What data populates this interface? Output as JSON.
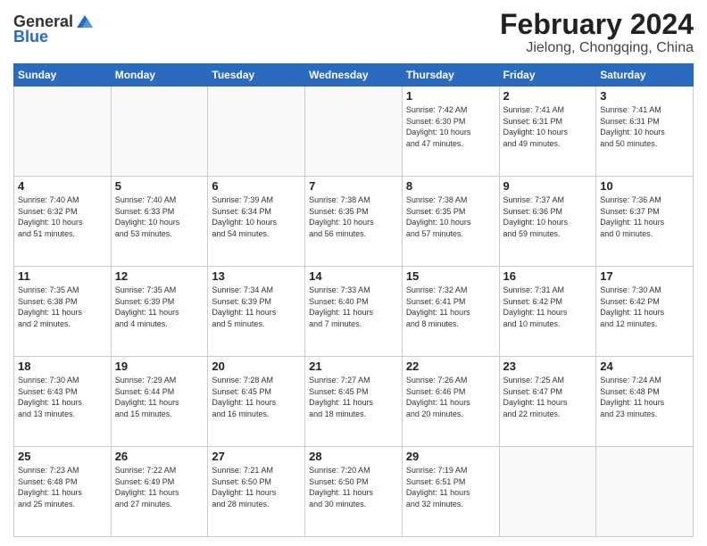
{
  "logo": {
    "general": "General",
    "blue": "Blue"
  },
  "title": "February 2024",
  "subtitle": "Jielong, Chongqing, China",
  "weekdays": [
    "Sunday",
    "Monday",
    "Tuesday",
    "Wednesday",
    "Thursday",
    "Friday",
    "Saturday"
  ],
  "weeks": [
    [
      {
        "day": "",
        "info": ""
      },
      {
        "day": "",
        "info": ""
      },
      {
        "day": "",
        "info": ""
      },
      {
        "day": "",
        "info": ""
      },
      {
        "day": "1",
        "info": "Sunrise: 7:42 AM\nSunset: 6:30 PM\nDaylight: 10 hours\nand 47 minutes."
      },
      {
        "day": "2",
        "info": "Sunrise: 7:41 AM\nSunset: 6:31 PM\nDaylight: 10 hours\nand 49 minutes."
      },
      {
        "day": "3",
        "info": "Sunrise: 7:41 AM\nSunset: 6:31 PM\nDaylight: 10 hours\nand 50 minutes."
      }
    ],
    [
      {
        "day": "4",
        "info": "Sunrise: 7:40 AM\nSunset: 6:32 PM\nDaylight: 10 hours\nand 51 minutes."
      },
      {
        "day": "5",
        "info": "Sunrise: 7:40 AM\nSunset: 6:33 PM\nDaylight: 10 hours\nand 53 minutes."
      },
      {
        "day": "6",
        "info": "Sunrise: 7:39 AM\nSunset: 6:34 PM\nDaylight: 10 hours\nand 54 minutes."
      },
      {
        "day": "7",
        "info": "Sunrise: 7:38 AM\nSunset: 6:35 PM\nDaylight: 10 hours\nand 56 minutes."
      },
      {
        "day": "8",
        "info": "Sunrise: 7:38 AM\nSunset: 6:35 PM\nDaylight: 10 hours\nand 57 minutes."
      },
      {
        "day": "9",
        "info": "Sunrise: 7:37 AM\nSunset: 6:36 PM\nDaylight: 10 hours\nand 59 minutes."
      },
      {
        "day": "10",
        "info": "Sunrise: 7:36 AM\nSunset: 6:37 PM\nDaylight: 11 hours\nand 0 minutes."
      }
    ],
    [
      {
        "day": "11",
        "info": "Sunrise: 7:35 AM\nSunset: 6:38 PM\nDaylight: 11 hours\nand 2 minutes."
      },
      {
        "day": "12",
        "info": "Sunrise: 7:35 AM\nSunset: 6:39 PM\nDaylight: 11 hours\nand 4 minutes."
      },
      {
        "day": "13",
        "info": "Sunrise: 7:34 AM\nSunset: 6:39 PM\nDaylight: 11 hours\nand 5 minutes."
      },
      {
        "day": "14",
        "info": "Sunrise: 7:33 AM\nSunset: 6:40 PM\nDaylight: 11 hours\nand 7 minutes."
      },
      {
        "day": "15",
        "info": "Sunrise: 7:32 AM\nSunset: 6:41 PM\nDaylight: 11 hours\nand 8 minutes."
      },
      {
        "day": "16",
        "info": "Sunrise: 7:31 AM\nSunset: 6:42 PM\nDaylight: 11 hours\nand 10 minutes."
      },
      {
        "day": "17",
        "info": "Sunrise: 7:30 AM\nSunset: 6:42 PM\nDaylight: 11 hours\nand 12 minutes."
      }
    ],
    [
      {
        "day": "18",
        "info": "Sunrise: 7:30 AM\nSunset: 6:43 PM\nDaylight: 11 hours\nand 13 minutes."
      },
      {
        "day": "19",
        "info": "Sunrise: 7:29 AM\nSunset: 6:44 PM\nDaylight: 11 hours\nand 15 minutes."
      },
      {
        "day": "20",
        "info": "Sunrise: 7:28 AM\nSunset: 6:45 PM\nDaylight: 11 hours\nand 16 minutes."
      },
      {
        "day": "21",
        "info": "Sunrise: 7:27 AM\nSunset: 6:45 PM\nDaylight: 11 hours\nand 18 minutes."
      },
      {
        "day": "22",
        "info": "Sunrise: 7:26 AM\nSunset: 6:46 PM\nDaylight: 11 hours\nand 20 minutes."
      },
      {
        "day": "23",
        "info": "Sunrise: 7:25 AM\nSunset: 6:47 PM\nDaylight: 11 hours\nand 22 minutes."
      },
      {
        "day": "24",
        "info": "Sunrise: 7:24 AM\nSunset: 6:48 PM\nDaylight: 11 hours\nand 23 minutes."
      }
    ],
    [
      {
        "day": "25",
        "info": "Sunrise: 7:23 AM\nSunset: 6:48 PM\nDaylight: 11 hours\nand 25 minutes."
      },
      {
        "day": "26",
        "info": "Sunrise: 7:22 AM\nSunset: 6:49 PM\nDaylight: 11 hours\nand 27 minutes."
      },
      {
        "day": "27",
        "info": "Sunrise: 7:21 AM\nSunset: 6:50 PM\nDaylight: 11 hours\nand 28 minutes."
      },
      {
        "day": "28",
        "info": "Sunrise: 7:20 AM\nSunset: 6:50 PM\nDaylight: 11 hours\nand 30 minutes."
      },
      {
        "day": "29",
        "info": "Sunrise: 7:19 AM\nSunset: 6:51 PM\nDaylight: 11 hours\nand 32 minutes."
      },
      {
        "day": "",
        "info": ""
      },
      {
        "day": "",
        "info": ""
      }
    ]
  ]
}
